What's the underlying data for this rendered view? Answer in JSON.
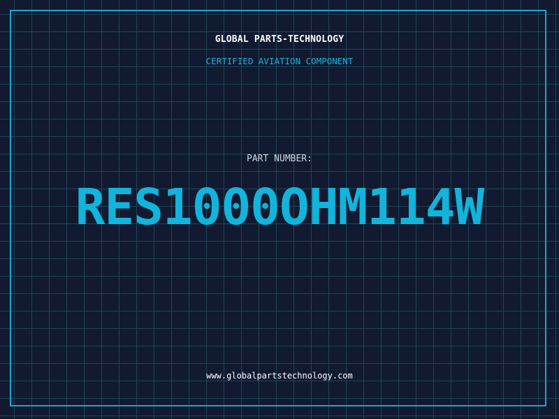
{
  "header": {
    "company": "GLOBAL PARTS-TECHNOLOGY",
    "subtitle": "CERTIFIED AVIATION COMPONENT"
  },
  "part": {
    "label": "PART NUMBER:",
    "number": "RES1000OHM114W"
  },
  "footer": {
    "url": "www.globalpartstechnology.com"
  },
  "colors": {
    "background": "#111a30",
    "grid": "#1d4659",
    "accent": "#12b4dc",
    "text": "#ffffff"
  }
}
